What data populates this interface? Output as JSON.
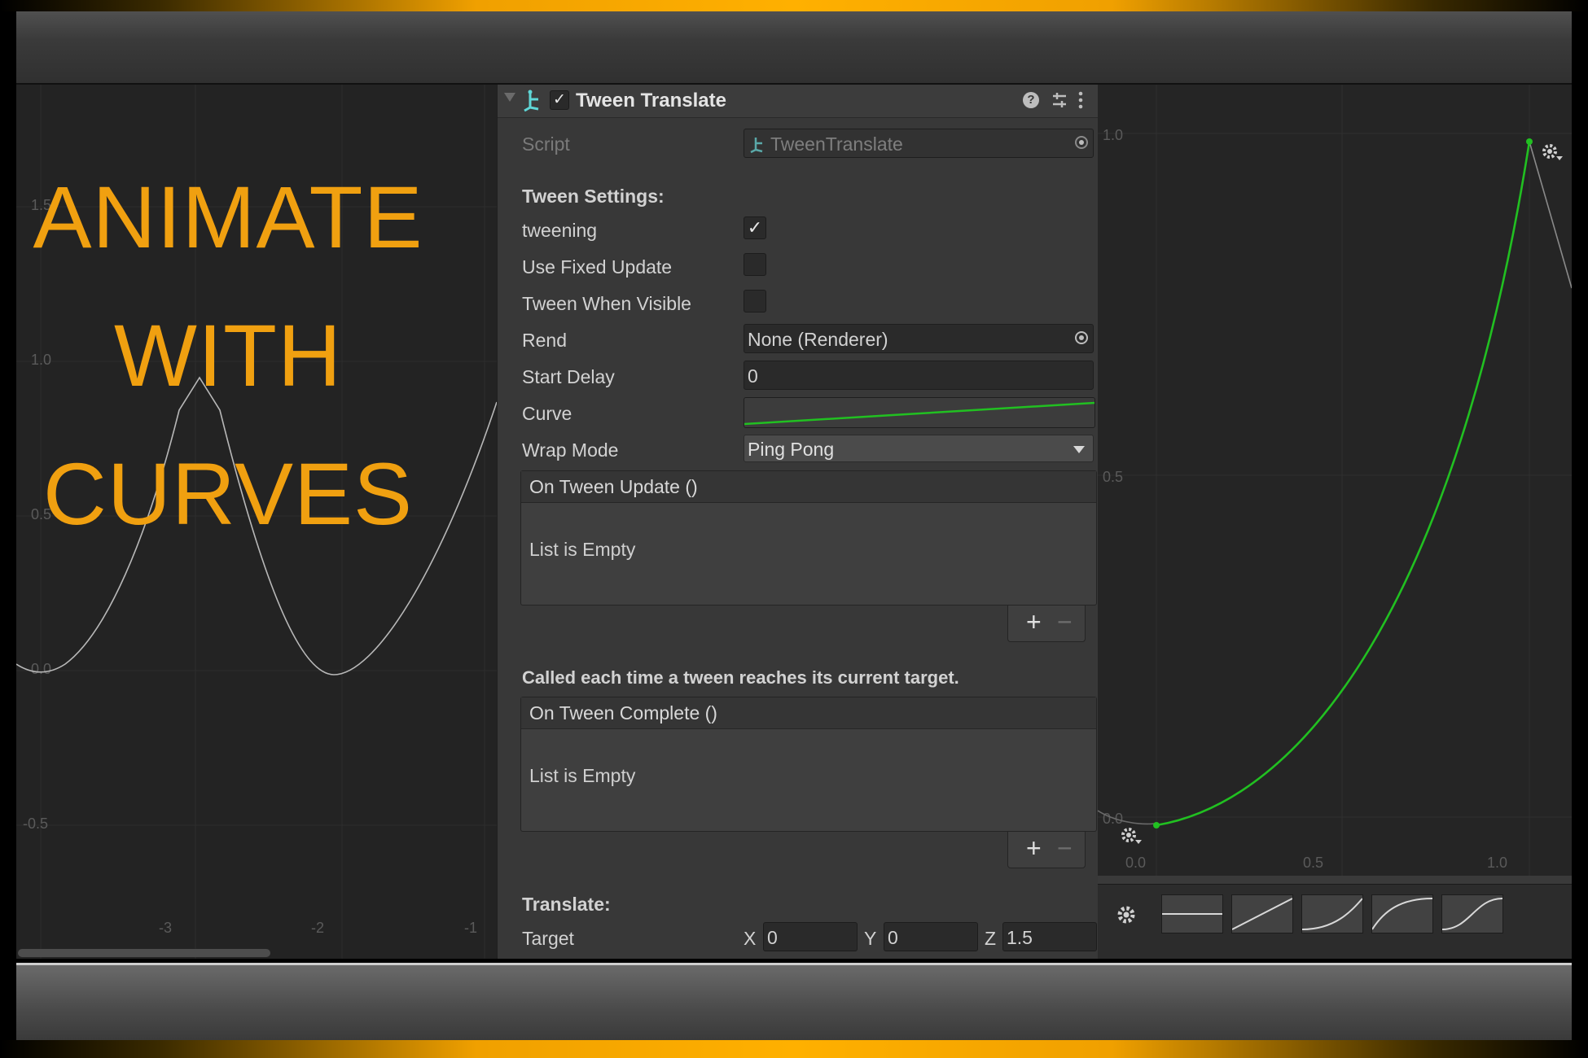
{
  "left_panel": {
    "headline": [
      "ANIMATE",
      "WITH",
      "CURVES"
    ],
    "y_ticks": [
      "1.5",
      "1.0",
      "0.5",
      "0.0",
      "-0.5"
    ],
    "x_ticks": [
      "-3",
      "-2",
      "-1"
    ]
  },
  "inspector": {
    "component_title": "Tween Translate",
    "script_label": "Script",
    "script_value": "TweenTranslate",
    "section_tween_settings": "Tween Settings:",
    "tweening_label": "tweening",
    "tweening_checked": true,
    "use_fixed_update_label": "Use Fixed Update",
    "use_fixed_update_checked": false,
    "tween_when_visible_label": "Tween When Visible",
    "tween_when_visible_checked": false,
    "rend_label": "Rend",
    "rend_value": "None (Renderer)",
    "start_delay_label": "Start Delay",
    "start_delay_value": "0",
    "curve_label": "Curve",
    "wrap_mode_label": "Wrap Mode",
    "wrap_mode_value": "Ping Pong",
    "on_tween_update_title": "On Tween Update ()",
    "on_tween_update_empty": "List is Empty",
    "complete_description": "Called each time a tween reaches its current target.",
    "on_tween_complete_title": "On Tween Complete ()",
    "on_tween_complete_empty": "List is Empty",
    "plus_label": "+",
    "minus_label": "−",
    "section_translate": "Translate:",
    "target_label": "Target",
    "target_x_label": "X",
    "target_x": "0",
    "target_y_label": "Y",
    "target_y": "0",
    "target_z_label": "Z",
    "target_z": "1.5",
    "check_glyph": "✓"
  },
  "right_panel": {
    "y_ticks": [
      "1.0",
      "0.5",
      "0.0"
    ],
    "x_ticks": [
      "0.0",
      "0.5",
      "1.0"
    ],
    "curve_color": "#21c021"
  },
  "colors": {
    "accent_orange": "#f0a010",
    "panel_bg": "#383838",
    "curve_green": "#21c021"
  }
}
